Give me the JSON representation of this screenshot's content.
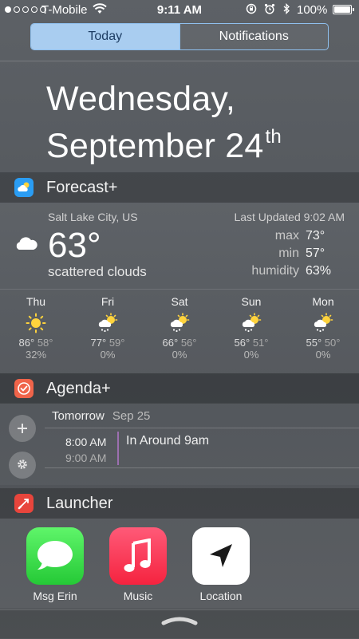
{
  "status_bar": {
    "signal_filled": 1,
    "signal_total": 5,
    "carrier": "T-Mobile",
    "time": "9:11 AM",
    "battery": "100%",
    "battery_level": 1.0
  },
  "tabs": [
    {
      "label": "Today",
      "selected": true
    },
    {
      "label": "Notifications",
      "selected": false
    }
  ],
  "date": {
    "line1": "Wednesday,",
    "line2": "September 24",
    "suffix": "th"
  },
  "forecast": {
    "title": "Forecast+",
    "location": "Salt Lake City, US",
    "last_updated": "Last Updated 9:02 AM",
    "current_temp": "63°",
    "condition": "scattered clouds",
    "condition_icon": "cloud-icon",
    "stats": [
      {
        "label": "max",
        "value": "73°"
      },
      {
        "label": "min",
        "value": "57°"
      },
      {
        "label": "humidity",
        "value": "63%"
      }
    ],
    "days": [
      {
        "day": "Thu",
        "icon": "sun-icon",
        "hi": "86°",
        "lo": "58°",
        "precip": "32%"
      },
      {
        "day": "Fri",
        "icon": "snow-sun-icon",
        "hi": "77°",
        "lo": "59°",
        "precip": "0%"
      },
      {
        "day": "Sat",
        "icon": "snow-sun-icon",
        "hi": "66°",
        "lo": "56°",
        "precip": "0%"
      },
      {
        "day": "Sun",
        "icon": "snow-sun-icon",
        "hi": "56°",
        "lo": "51°",
        "precip": "0%"
      },
      {
        "day": "Mon",
        "icon": "snow-sun-icon",
        "hi": "55°",
        "lo": "50°",
        "precip": "0%"
      }
    ]
  },
  "agenda": {
    "title": "Agenda+",
    "day_label": "Tomorrow",
    "day_date": "Sep 25",
    "add_icon": "plus-icon",
    "settings_icon": "gear-icon",
    "event": {
      "start": "8:00 AM",
      "end": "9:00 AM",
      "title": "In Around 9am",
      "color": "#9c6fb0"
    }
  },
  "launcher": {
    "title": "Launcher",
    "apps": [
      {
        "label": "Msg Erin",
        "icon": "messages-icon",
        "color": "#3dd94f"
      },
      {
        "label": "Music",
        "icon": "music-note-icon",
        "color": "#fc3d5a"
      },
      {
        "label": "Location",
        "icon": "location-arrow-icon",
        "color": "#ffffff"
      }
    ]
  },
  "colors": {
    "accent": "#a9cdf0",
    "forecast_icon": "#2a9df4",
    "agenda_icon": "#f0644a",
    "launcher_icon": "#e8453c"
  }
}
